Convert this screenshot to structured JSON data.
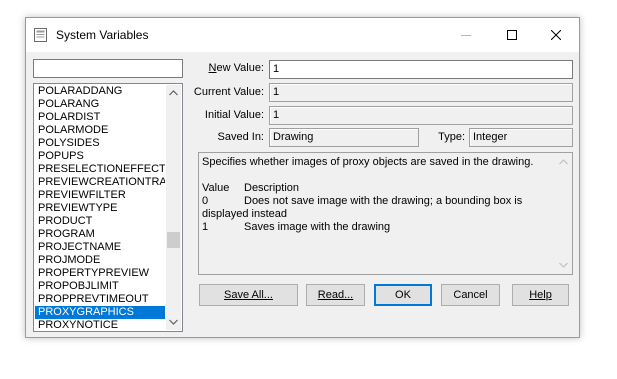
{
  "window": {
    "title": "System Variables"
  },
  "search": {
    "value": ""
  },
  "variables": [
    "POLARADDANG",
    "POLARANG",
    "POLARDIST",
    "POLARMODE",
    "POLYSIDES",
    "POPUPS",
    "PRESELECTIONEFFECT",
    "PREVIEWCREATIONTRA",
    "PREVIEWFILTER",
    "PREVIEWTYPE",
    "PRODUCT",
    "PROGRAM",
    "PROJECTNAME",
    "PROJMODE",
    "PROPERTYPREVIEW",
    "PROPOBJLIMIT",
    "PROPPREVTIMEOUT",
    "PROXYGRAPHICS",
    "PROXYNOTICE"
  ],
  "selected_variable": "PROXYGRAPHICS",
  "fields": {
    "new_value": {
      "label_first": "N",
      "label_rest": "ew Value:",
      "value": "1"
    },
    "current_value": {
      "label": "Current Value:",
      "value": "1"
    },
    "initial_value": {
      "label": "Initial Value:",
      "value": "1"
    },
    "saved_in": {
      "label": "Saved In:",
      "value": "Drawing"
    },
    "type": {
      "label": "Type:",
      "value": "Integer"
    }
  },
  "description": {
    "summary": "Specifies whether images of proxy objects are saved in the drawing.",
    "header_value": "Value",
    "header_desc": "Description",
    "row0_value": "0",
    "row0_desc": "Does not save image with the drawing; a bounding box is",
    "row0_cont": "displayed instead",
    "row1_value": "1",
    "row1_desc": "Saves image with the drawing"
  },
  "buttons": {
    "save_all": "Save All...",
    "read": "Read...",
    "ok": "OK",
    "cancel": "Cancel",
    "help": "Help"
  },
  "colors": {
    "selection": "#0078d7",
    "window_bg": "#f0f0f0"
  }
}
